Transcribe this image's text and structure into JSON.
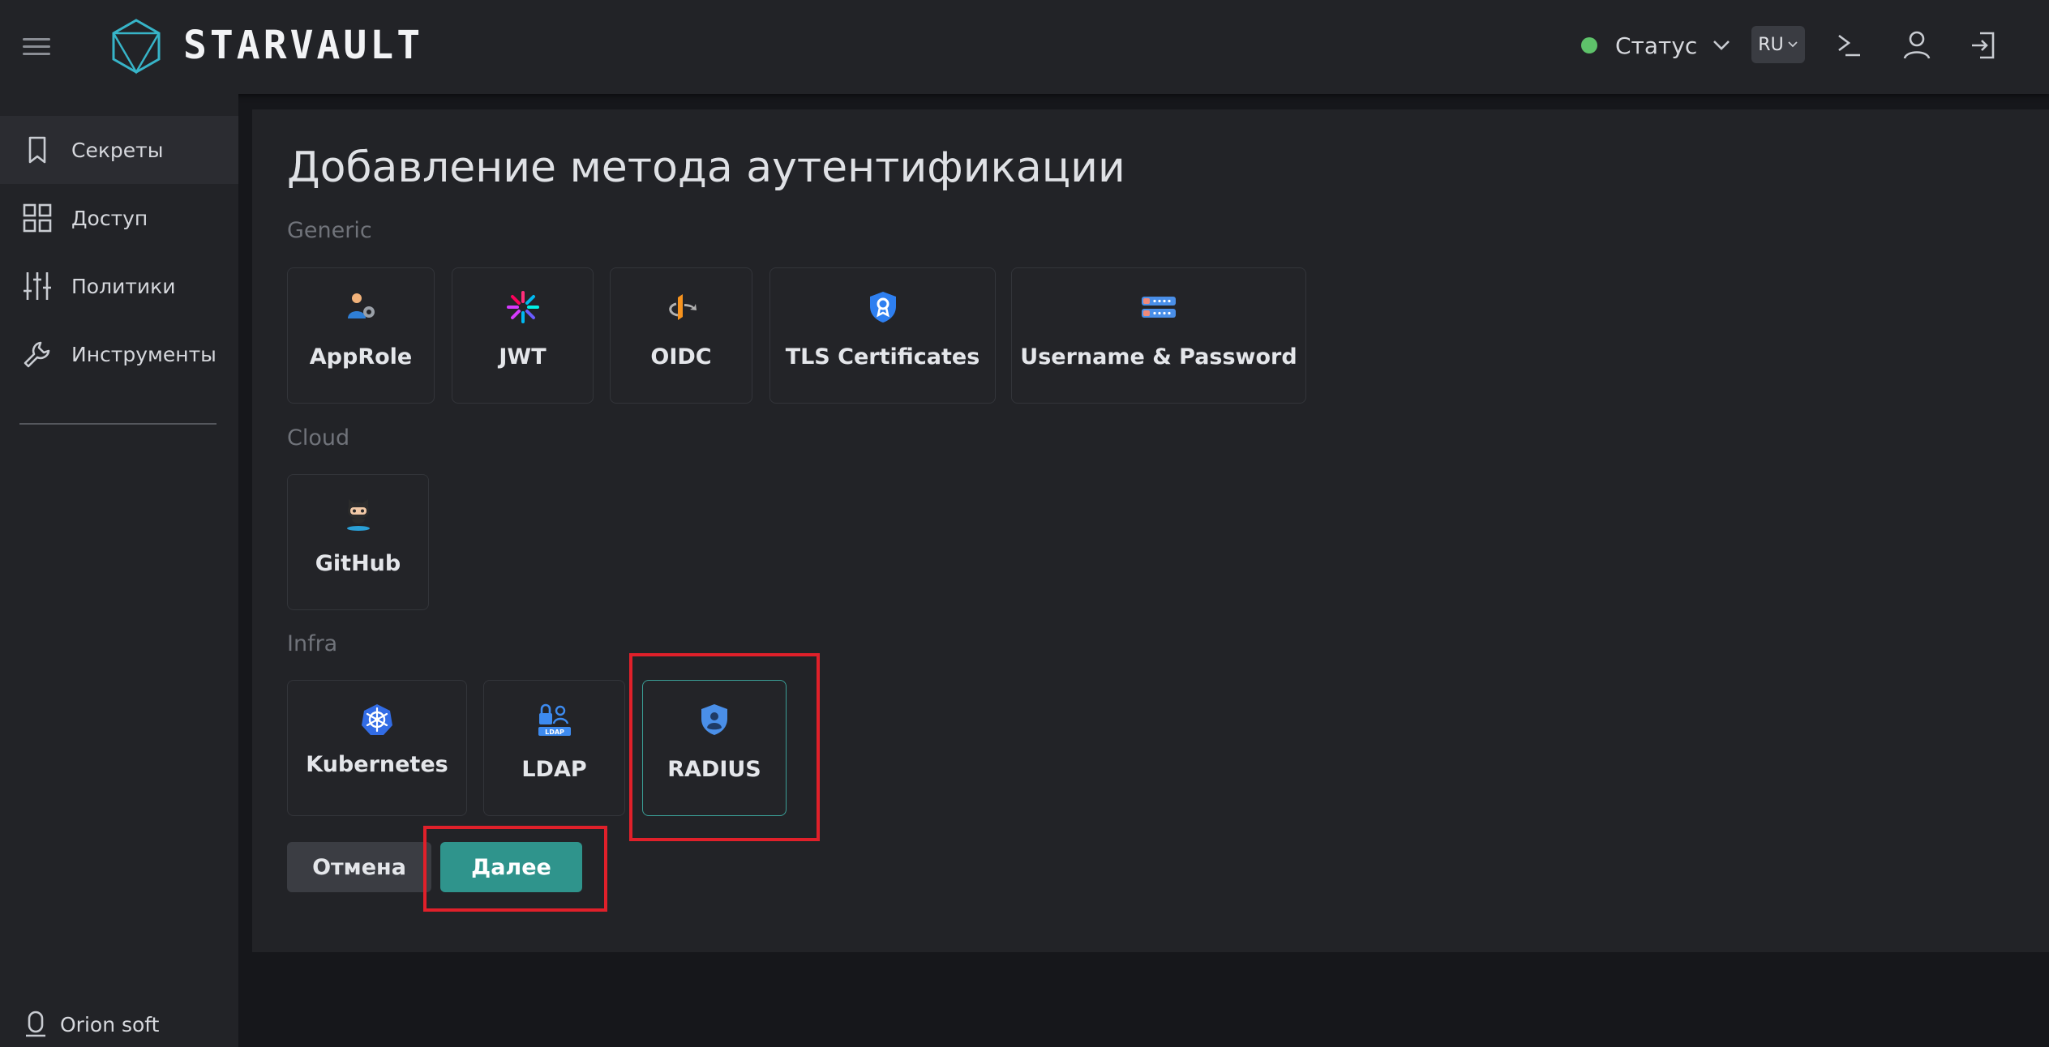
{
  "header": {
    "brand": "STARVAULT",
    "status_label": "Статус",
    "lang_label": "RU",
    "status_color": "#5ec26a",
    "icons": [
      "menu-icon",
      "starvault-logo",
      "chevron-down-icon",
      "terminal-icon",
      "user-icon",
      "logout-icon"
    ]
  },
  "sidebar": {
    "items": [
      {
        "label": "Секреты",
        "icon": "bookmark-icon"
      },
      {
        "label": "Доступ",
        "icon": "grid-icon"
      },
      {
        "label": "Политики",
        "icon": "sliders-icon"
      },
      {
        "label": "Инструменты",
        "icon": "wrench-icon"
      }
    ],
    "footer_label": "Orion soft"
  },
  "main": {
    "title": "Добавление метода аутентификации",
    "sections": [
      {
        "label": "Generic",
        "cards": [
          {
            "label": "AppRole",
            "icon": "approle-icon"
          },
          {
            "label": "JWT",
            "icon": "jwt-icon"
          },
          {
            "label": "OIDC",
            "icon": "oidc-icon"
          },
          {
            "label": "TLS Certificates",
            "icon": "tls-certificate-icon"
          },
          {
            "label": "Username & Password",
            "icon": "userpass-icon"
          }
        ]
      },
      {
        "label": "Cloud",
        "cards": [
          {
            "label": "GitHub",
            "icon": "github-icon"
          }
        ]
      },
      {
        "label": "Infra",
        "cards": [
          {
            "label": "Kubernetes",
            "icon": "kubernetes-icon"
          },
          {
            "label": "LDAP",
            "icon": "ldap-icon",
            "icon_text": "LDAP"
          },
          {
            "label": "RADIUS",
            "icon": "radius-icon",
            "selected": true
          }
        ]
      }
    ],
    "buttons": {
      "cancel": "Отмена",
      "next": "Далее"
    },
    "accent_color": "#2f948c",
    "highlight_color": "#e0202a"
  }
}
